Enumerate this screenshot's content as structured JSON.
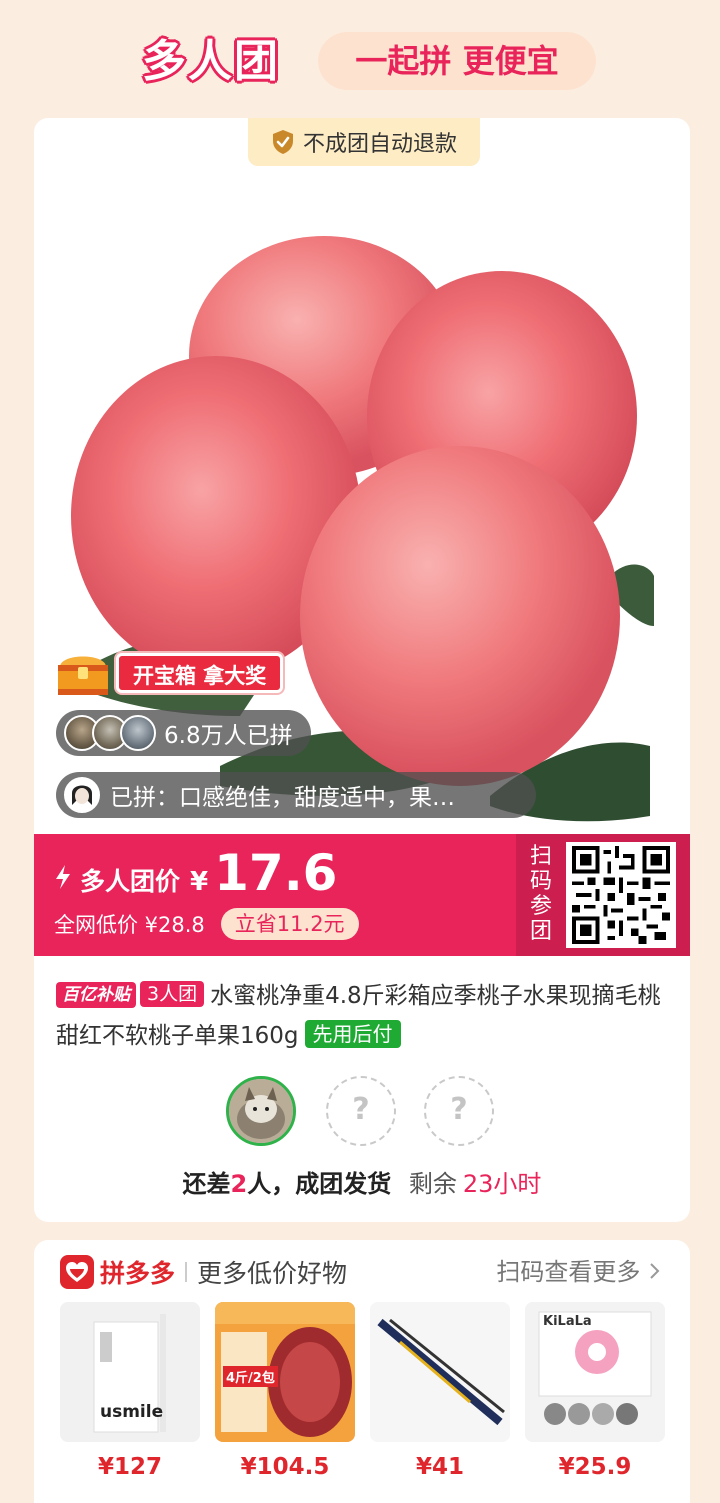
{
  "header": {
    "logo_text": "多人团",
    "slogan": "一起拼 更便宜"
  },
  "product": {
    "refund_tag": "不成团自动退款",
    "treasure_label": "开宝箱 拿大奖",
    "joined_count": "6.8万人已拼",
    "review_text": "已拼：口感绝佳，甜度适中，果…",
    "price_label": "多人团价",
    "currency": "¥",
    "price": "17.6",
    "market_price": "全网低价 ¥28.8",
    "save_amount": "立省11.2元",
    "scan_label": "扫码参团",
    "subsidy_tag": "百亿补贴",
    "group_tag": "3人团",
    "title": "水蜜桃净重4.8斤彩箱应季桃子水果现摘毛桃甜红不软桃子单果160g",
    "pay_tag": "先用后付",
    "placeholder_mark": "?",
    "status_prefix": "还差",
    "status_count": "2",
    "status_suffix": "人，成团发货",
    "remain_label": "剩余",
    "remain_time": "23小时"
  },
  "recommend": {
    "brand": "拼多多",
    "title": "更多低价好物",
    "more": "扫码查看更多",
    "items": [
      {
        "price": "¥127",
        "image_text": "usmile"
      },
      {
        "price": "¥104.5",
        "image_text": "4斤/2包"
      },
      {
        "price": "¥41",
        "image_text": ""
      },
      {
        "price": "¥25.9",
        "image_text": "KiLaLa"
      }
    ]
  },
  "colors": {
    "brand_pink": "#e8245a",
    "background": "#fbeee1",
    "green_tag": "#1faa34"
  },
  "icons": [
    "shield-check-icon",
    "treasure-chest-icon",
    "lightning-bolt-icon",
    "qr-code-icon",
    "pinduoduo-logo-icon",
    "chevron-right-icon"
  ]
}
